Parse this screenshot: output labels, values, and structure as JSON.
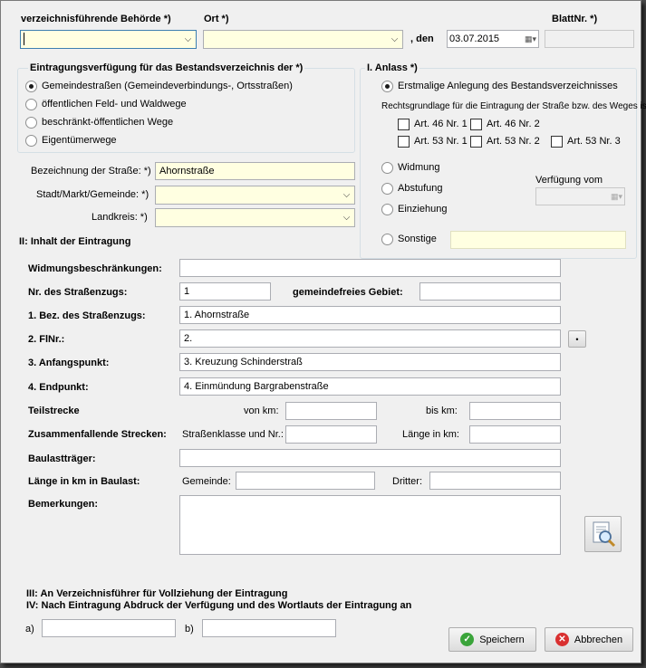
{
  "header": {
    "behoerde_label": "verzeichnisführende Behörde *)",
    "ort_label": "Ort *)",
    "den_label": ", den",
    "date_value": "03.07.2015",
    "blatt_label": "BlattNr. *)"
  },
  "verfuegung": {
    "title": "Eintragungsverfügung für das Bestandsverzeichnis der *)",
    "options": [
      "Gemeindestraßen (Gemeindeverbindungs-, Ortsstraßen)",
      "öffentlichen Feld- und Waldwege",
      "beschränkt-öffentlichen Wege",
      "Eigentümerwege"
    ]
  },
  "strasse": {
    "bez_label": "Bezeichnung der Straße: *)",
    "bez_value": "Ahornstraße",
    "stadt_label": "Stadt/Markt/Gemeinde: *)",
    "landkreis_label": "Landkreis: *)"
  },
  "anlass": {
    "title": "I. Anlass *)",
    "first_option": "Erstmalige Anlegung des Bestandsverzeichnisses",
    "rechtsgrundlage": "Rechtsgrundlage für die Eintragung der Straße bzw. des Weges ist:",
    "art": [
      "Art. 46 Nr. 1",
      "Art. 46 Nr. 2",
      "Art. 53 Nr. 1",
      "Art. 53 Nr. 2",
      "Art. 53 Nr. 3"
    ],
    "widmung": "Widmung",
    "abstufung": "Abstufung",
    "einziehung": "Einziehung",
    "sonstige": "Sonstige",
    "verfuegung_vom": "Verfügung vom"
  },
  "inhalt": {
    "title": "II: Inhalt der Eintragung",
    "widmungsbeschr": "Widmungsbeschränkungen:",
    "nr_label": "Nr. des Straßenzugs:",
    "nr_value": "1",
    "gemeindefrei": "gemeindefreies Gebiet:",
    "bez_label": "1. Bez. des Straßenzugs:",
    "bez_value": "1. Ahornstraße",
    "flnr_label": "2. FlNr.:",
    "flnr_value": "2.",
    "anfang_label": "3. Anfangspunkt:",
    "anfang_value": "3. Kreuzung Schinderstraß",
    "end_label": "4. Endpunkt:",
    "end_value": "4. Einmündung Bargrabenstraße",
    "teilstrecke": "Teilstrecke",
    "von_km": "von km:",
    "bis_km": "bis km:",
    "zusammen": "Zusammenfallende Strecken:",
    "strassenklasse": "Straßenklasse und Nr.:",
    "laenge_km": "Länge in km:",
    "baulasttraeger": "Baulastträger:",
    "laenge_baulast": "Länge in km in Baulast:",
    "gemeinde": "Gemeinde:",
    "dritter": "Dritter:",
    "bemerkungen": "Bemerkungen:",
    "small_btn": "•"
  },
  "footer": {
    "line3": "III: An Verzeichnisführer für Vollziehung der Eintragung",
    "line4": "IV: Nach Eintragung Abdruck der Verfügung und des Wortlauts der Eintragung an",
    "a_label": "a)",
    "b_label": "b)",
    "save": "Speichern",
    "cancel": "Abbrechen"
  },
  "colors": {
    "required_bg": "#ffffe1",
    "save_icon": "#3aa43a",
    "cancel_icon": "#d93030"
  },
  "icons": {
    "save": "check-circle-icon",
    "cancel": "x-circle-icon",
    "search": "document-search-icon",
    "dropdown": "chevron-down-icon",
    "calendar": "calendar-icon"
  }
}
